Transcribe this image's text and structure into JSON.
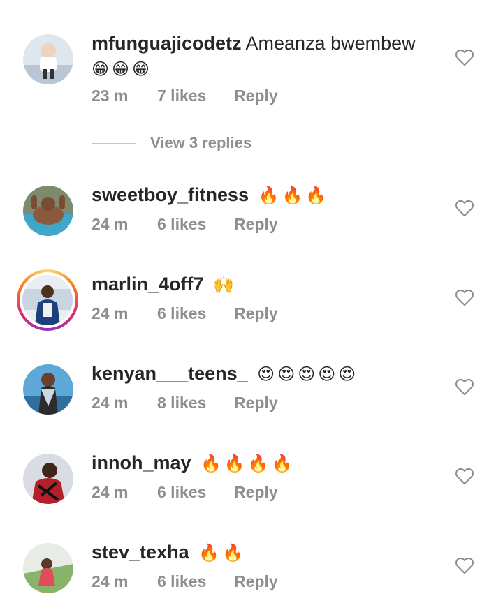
{
  "icons": {
    "heart": "heart-outline-icon"
  },
  "colors": {
    "text": "#262626",
    "meta": "#8e8e8e",
    "divider": "#c7c7c7"
  },
  "comments": [
    {
      "username": "mfunguajicodetz",
      "text": "Ameanza bwembew",
      "emojis": "😁😁😁",
      "time": "23 m",
      "likes": "7 likes",
      "reply": "Reply"
    },
    {
      "username": "sweetboy_fitness",
      "text": "",
      "emojis": "🔥🔥🔥",
      "time": "24 m",
      "likes": "6 likes",
      "reply": "Reply"
    },
    {
      "username": "marlin_4off7",
      "text": "",
      "emojis": "🙌",
      "time": "24 m",
      "likes": "6 likes",
      "reply": "Reply"
    },
    {
      "username": "kenyan___teens_",
      "text": "",
      "emojis": "😍😍😍😍😍",
      "time": "24 m",
      "likes": "8 likes",
      "reply": "Reply"
    },
    {
      "username": "innoh_may",
      "text": "",
      "emojis": "🔥🔥🔥🔥",
      "time": "24 m",
      "likes": "6 likes",
      "reply": "Reply"
    },
    {
      "username": "stev_texha",
      "text": "",
      "emojis": "🔥🔥",
      "time": "24 m",
      "likes": "6 likes",
      "reply": "Reply"
    }
  ],
  "view_replies": "View 3 replies"
}
